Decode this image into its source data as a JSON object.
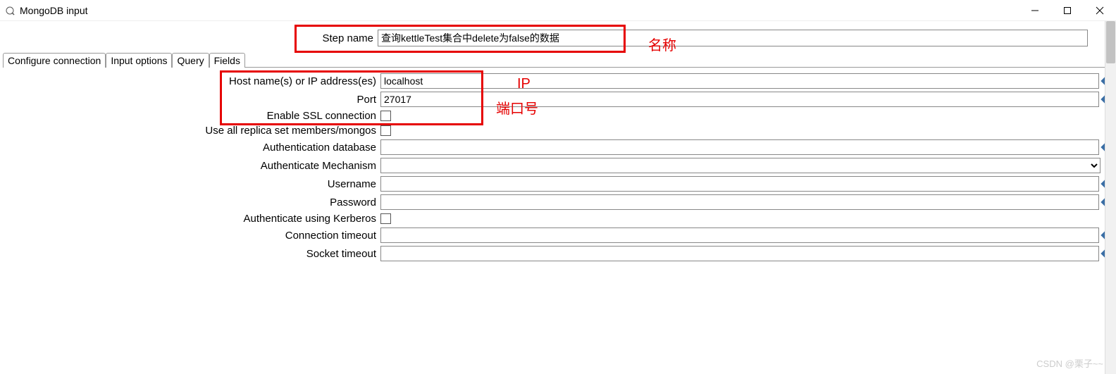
{
  "window": {
    "title": "MongoDB input"
  },
  "step": {
    "label": "Step name",
    "value": "查询kettleTest集合中delete为false的数据"
  },
  "tabs": {
    "configure": "Configure connection",
    "input": "Input options",
    "query": "Query",
    "fields": "Fields"
  },
  "fields": {
    "host_label": "Host name(s) or IP address(es)",
    "host_value": "localhost",
    "port_label": "Port",
    "port_value": "27017",
    "ssl_label": "Enable SSL connection",
    "replica_label": "Use all replica set members/mongos",
    "authdb_label": "Authentication database",
    "authdb_value": "",
    "authmech_label": "Authenticate Mechanism",
    "username_label": "Username",
    "username_value": "",
    "password_label": "Password",
    "password_value": "",
    "kerberos_label": "Authenticate using Kerberos",
    "conntimeout_label": "Connection timeout",
    "conntimeout_value": "",
    "socktimeout_label": "Socket timeout",
    "socktimeout_value": ""
  },
  "annotations": {
    "name": "名称",
    "ip": "IP",
    "port": "端口号"
  },
  "watermark": "CSDN @栗子~~"
}
